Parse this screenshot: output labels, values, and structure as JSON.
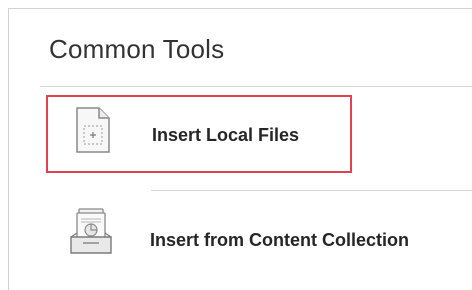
{
  "panel": {
    "title": "Common Tools"
  },
  "tools": [
    {
      "label": "Insert Local Files",
      "icon": "local-file-icon",
      "highlighted": true
    },
    {
      "label": "Insert from Content Collection",
      "icon": "content-collection-icon",
      "highlighted": false
    }
  ],
  "colors": {
    "highlight_border": "#e0434f",
    "icon_stroke": "#8a8a8a",
    "divider": "#d6d6d6"
  }
}
